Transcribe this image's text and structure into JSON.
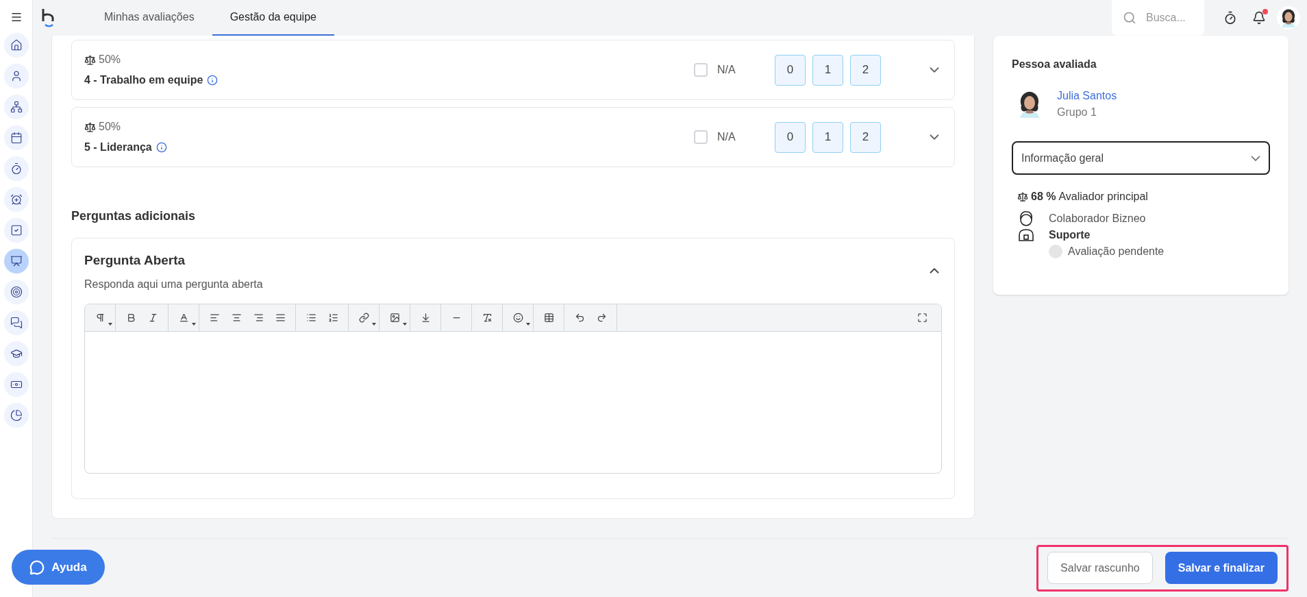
{
  "nav": {
    "tabs": [
      {
        "label": "Minhas avaliações",
        "selected": false
      },
      {
        "label": "Gestão da equipe",
        "selected": true
      }
    ],
    "search": {
      "placeholder": "Busca..."
    },
    "notifications": {
      "unread": true
    }
  },
  "sidebar": {
    "items": [
      {
        "selected": false
      },
      {
        "selected": false
      },
      {
        "selected": false
      },
      {
        "selected": false
      },
      {
        "selected": false
      },
      {
        "selected": false
      },
      {
        "selected": false
      },
      {
        "selected": true
      },
      {
        "selected": false
      },
      {
        "selected": false
      },
      {
        "selected": false
      },
      {
        "selected": false
      },
      {
        "selected": false
      }
    ]
  },
  "criteria": [
    {
      "weight": "50%",
      "title": "4 - Trabalho em equipe",
      "na_label": "N/A",
      "na_checked": false,
      "expanded": false,
      "scores": [
        {
          "label": "0",
          "selected": false
        },
        {
          "label": "1",
          "selected": false
        },
        {
          "label": "2",
          "selected": false
        }
      ]
    },
    {
      "weight": "50%",
      "title": "5 - Liderança",
      "na_label": "N/A",
      "na_checked": false,
      "expanded": false,
      "scores": [
        {
          "label": "0",
          "selected": false
        },
        {
          "label": "1",
          "selected": false
        },
        {
          "label": "2",
          "selected": false
        }
      ]
    }
  ],
  "additional": {
    "heading": "Perguntas adicionais",
    "question": {
      "title": "Pergunta Aberta",
      "description": "Responda aqui uma pergunta aberta",
      "expanded": true
    }
  },
  "evaluated": {
    "heading": "Pessoa avaliada",
    "name": "Julia Santos",
    "group": "Grupo 1",
    "view_select": "Informação geral",
    "weight_value": "68 %",
    "evaluator_role": "Avaliador principal",
    "evaluator_name": "Colaborador Bizneo",
    "evaluator_dept": "Suporte",
    "status": "Avaliação pendente"
  },
  "footer": {
    "highlighted": true,
    "buttons": [
      {
        "label": "Salvar rascunho",
        "kind": "secondary"
      },
      {
        "label": "Salvar e finalizar",
        "kind": "primary"
      }
    ]
  },
  "help": {
    "label": "Ayuda"
  }
}
